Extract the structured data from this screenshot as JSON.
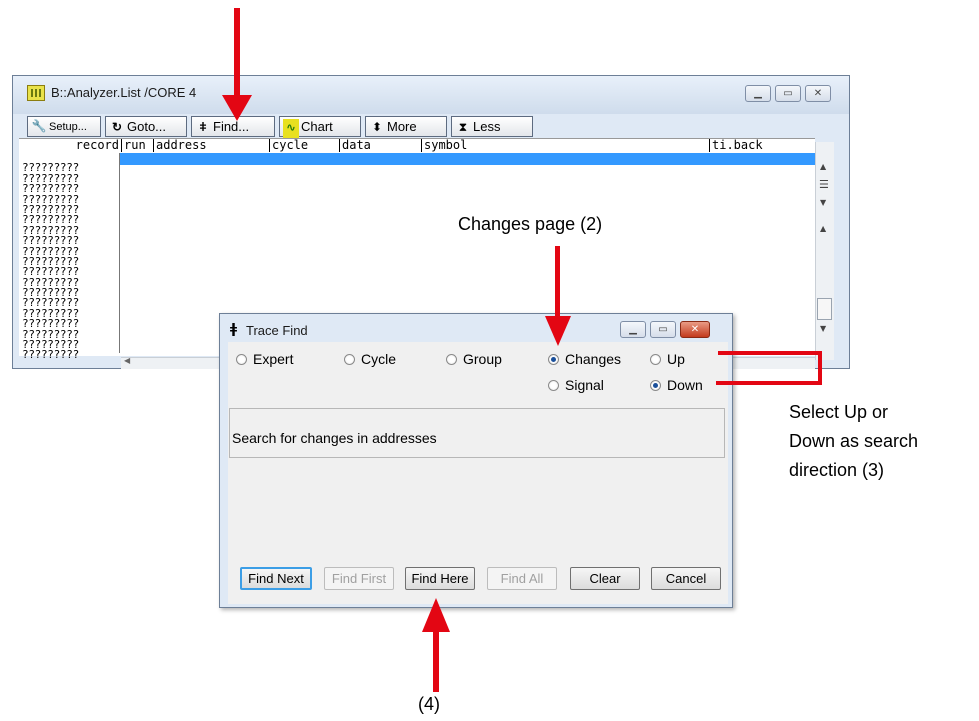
{
  "analyzer_window": {
    "title": "B::Analyzer.List /CORE 4",
    "toolbar": {
      "setup": "Setup...",
      "goto": "Goto...",
      "find": "Find...",
      "chart": "Chart",
      "more": "More",
      "less": "Less"
    },
    "columns": [
      "record",
      "run",
      "address",
      "cycle",
      "data",
      "symbol",
      "ti.back"
    ],
    "records": [
      "?????????",
      "?????????",
      "?????????",
      "?????????",
      "?????????",
      "?????????",
      "?????????",
      "?????????",
      "?????????",
      "?????????",
      "?????????",
      "?????????",
      "?????????",
      "?????????",
      "?????????",
      "?????????",
      "?????????",
      "?????????",
      "?????????",
      "?????????"
    ]
  },
  "trace_find_dialog": {
    "title": "Trace Find",
    "modes": {
      "expert": "Expert",
      "cycle": "Cycle",
      "group": "Group",
      "changes": "Changes",
      "signal": "Signal"
    },
    "selected_mode": "Changes",
    "direction": {
      "up": "Up",
      "down": "Down",
      "selected": "Down"
    },
    "info": "Search for changes in addresses",
    "buttons": {
      "find_next": "Find Next",
      "find_first": "Find First",
      "find_here": "Find Here",
      "find_all": "Find All",
      "clear": "Clear",
      "cancel": "Cancel"
    }
  },
  "annotations": {
    "changes_page": "Changes page (2)",
    "direction_note_line1": "Select Up or",
    "direction_note_line2": "Down as search",
    "direction_note_line3": "direction (3)",
    "step4": "(4)"
  },
  "colors": {
    "annotation_red": "#e30613",
    "selection_blue": "#3399ff",
    "window_frame": "#dfe9f5"
  }
}
